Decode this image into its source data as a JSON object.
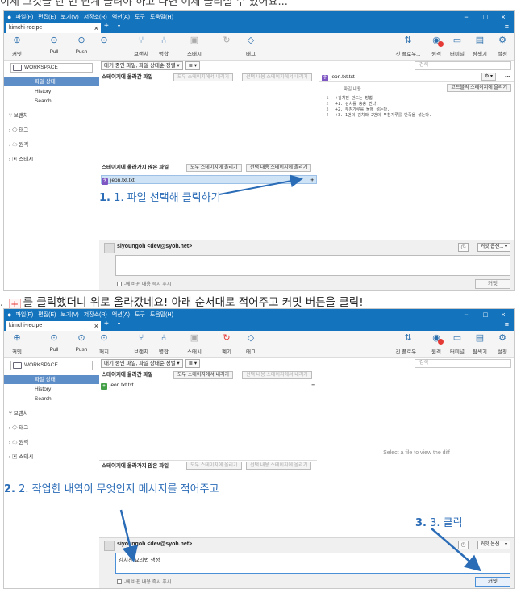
{
  "caption_top": "이제 그것을 한 번 단계 올려야 하고 나면 이제 올리실 수 있어요...",
  "caption_mid_before": "를 클릭했더니 위로 올라갔네요! 아래 순서대로 적어주고 커밋 버튼을 클릭!",
  "caption_bullet": ".",
  "plus_glyph": "+",
  "colors": {
    "titlebar": "#1473bd",
    "selection": "#5e8ec7",
    "annotation": "#2b6cb7",
    "untracked": "#7e57c2",
    "added": "#43a047",
    "warning": "#e53935"
  },
  "app": {
    "menu": [
      "파일(F)",
      "편집(E)",
      "보기(V)",
      "저장소(R)",
      "액션(A)",
      "도구",
      "도움말(H)"
    ],
    "window_controls": [
      "−",
      "□",
      "×"
    ],
    "tab_name": "kimchi-recipe",
    "tab_close": "×",
    "tab_add": "+",
    "tab_menu": "▾",
    "hamburger": "≡",
    "toolbar_left_s1": [
      {
        "label": "커밋",
        "icon": "⊕"
      },
      {
        "label": "Pull",
        "icon": "⊙"
      },
      {
        "label": "Push",
        "icon": "⊙"
      },
      {
        "label": "",
        "icon": "⊙"
      },
      {
        "label": "브랜치",
        "icon": "⑂"
      },
      {
        "label": "병합",
        "icon": "⑃"
      },
      {
        "label": "스태시",
        "icon": "▣"
      },
      {
        "label": "",
        "icon": "↻"
      },
      {
        "label": "태그",
        "icon": "◇"
      }
    ],
    "toolbar_left_s2": [
      {
        "label": "커밋",
        "icon": "⊕"
      },
      {
        "label": "Pull",
        "icon": "⊙"
      },
      {
        "label": "Push",
        "icon": "⊙"
      },
      {
        "label": "패치",
        "icon": "⊙"
      },
      {
        "label": "브랜치",
        "icon": "⑂"
      },
      {
        "label": "병합",
        "icon": "⑃"
      },
      {
        "label": "스태시",
        "icon": "▣"
      },
      {
        "label": "폐기",
        "icon": "↻"
      },
      {
        "label": "태그",
        "icon": "◇"
      }
    ],
    "toolbar_right": [
      {
        "label": "깃 플로우...",
        "icon": "⇅"
      },
      {
        "label": "원격",
        "icon": "◉"
      },
      {
        "label": "터미널",
        "icon": "▭"
      },
      {
        "label": "탐색기",
        "icon": "▤"
      },
      {
        "label": "설정",
        "icon": "⚙"
      }
    ],
    "sidebar": {
      "workspace": "WORKSPACE",
      "items": [
        "파일 상태",
        "History",
        "Search"
      ],
      "groups": [
        "브랜치",
        "태그",
        "원격",
        "스태시"
      ]
    },
    "filter_label": "대기 중인 파일, 파일 상태순 정렬",
    "filter_view": "≣",
    "search_placeholder": "검색",
    "staged_title": "스테이지에 올라간 파일",
    "unstage_all": "모두 스테이지에서 내리기",
    "unstage_sel": "선택 내용 스테이지에서 내리기",
    "unstaged_title": "스테이지에 올라가지 않은 파일",
    "stage_all": "모두 스테이지에 올리기",
    "stage_sel": "선택 내용 스테이지에 올리기",
    "file_name": "jeon.txt.txt",
    "file_untracked_badge": "?",
    "file_added_badge": "+",
    "diff_file": "jeon.txt.txt",
    "diff_gear": "⚙ ▾",
    "diff_more": "•••",
    "diff_col_label": "파일 내용",
    "diff_stage_btn": "코드블럭 스테이지에 올리기",
    "diff_lines": [
      {
        "n": "1",
        "t": "+김치전 만드는 방법"
      },
      {
        "n": "2",
        "t": "+1. 김치를 송송 썬다."
      },
      {
        "n": "3",
        "t": "+2. 부침가루를 물에 섞는다."
      },
      {
        "n": "4",
        "t": "+3. 1번의 김치와 2번의 부침가루를 반죽을 섞는다."
      }
    ],
    "diff_empty": "Select a file to view the diff",
    "author": "siyoungoh <dev@syoh.net>",
    "commit_options": "커밋 옵션...",
    "commit_message": "김치전 요리법 생성",
    "push_label": "-에 바뀐 내용 즉시 푸시",
    "commit_button": "커밋"
  },
  "annotations": {
    "step1": "1. 파일 선택해 클릭하기",
    "step2": "2. 작업한 내역이 무엇인지 메시지를 적어주고",
    "step3": "3. 클릭"
  }
}
